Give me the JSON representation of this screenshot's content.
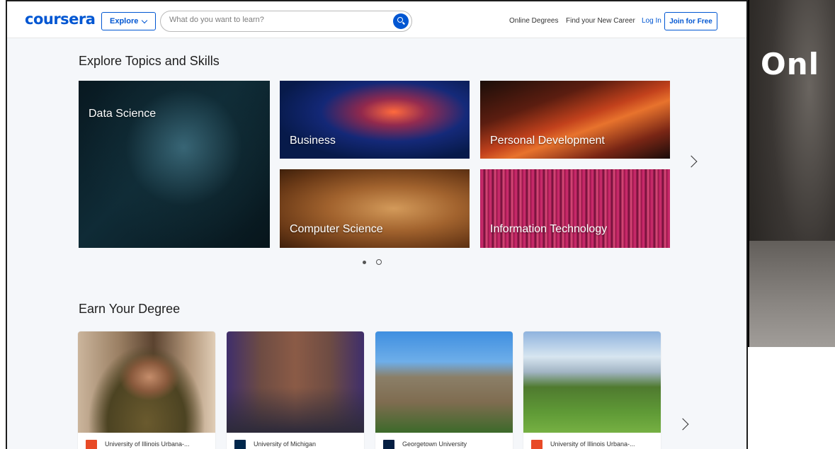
{
  "header": {
    "logo_text": "coursera",
    "explore_label": "Explore",
    "search_placeholder": "What do you want to learn?",
    "links": [
      "Online Degrees",
      "Find your New Career",
      "Log In"
    ],
    "join_label": "Join for Free"
  },
  "topics": {
    "title": "Explore Topics and Skills",
    "items": [
      {
        "label": "Data Science"
      },
      {
        "label": "Business"
      },
      {
        "label": "Personal Development"
      },
      {
        "label": "Computer Science"
      },
      {
        "label": "Information Technology"
      }
    ],
    "pagination": {
      "pages": 2,
      "current": 1
    }
  },
  "degrees": {
    "title": "Earn Your Degree",
    "items": [
      {
        "university": "University of Illinois Urbana-...",
        "logo_color": "#e84a27"
      },
      {
        "university": "University of Michigan",
        "logo_color": "#00274c"
      },
      {
        "university": "Georgetown University",
        "logo_color": "#041e42"
      },
      {
        "university": "University of Illinois Urbana-...",
        "logo_color": "#e84a27"
      }
    ]
  },
  "video_overlay": {
    "title": "Onl"
  },
  "colors": {
    "brand": "#0056d2",
    "page_bg": "#f5f7fa"
  }
}
